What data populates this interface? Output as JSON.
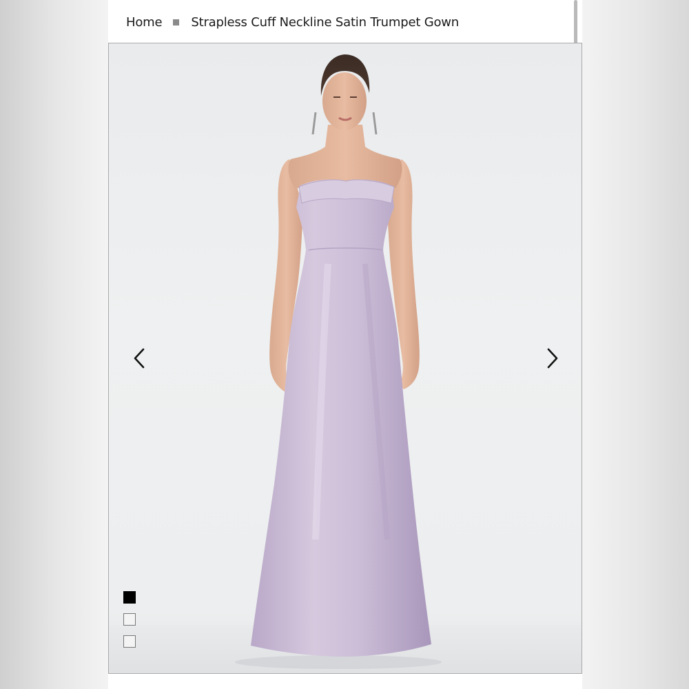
{
  "breadcrumb": {
    "home": "Home",
    "current": "Strapless Cuff Neckline Satin Trumpet Gown"
  },
  "gallery": {
    "photo_name": "lavender-satin-trumpet-gown-photo",
    "gown_color": "#cdbfd6",
    "slides": [
      {
        "active": true
      },
      {
        "active": false
      },
      {
        "active": false
      }
    ]
  },
  "icons": {
    "prev": "chevron-left-icon",
    "next": "chevron-right-icon"
  }
}
